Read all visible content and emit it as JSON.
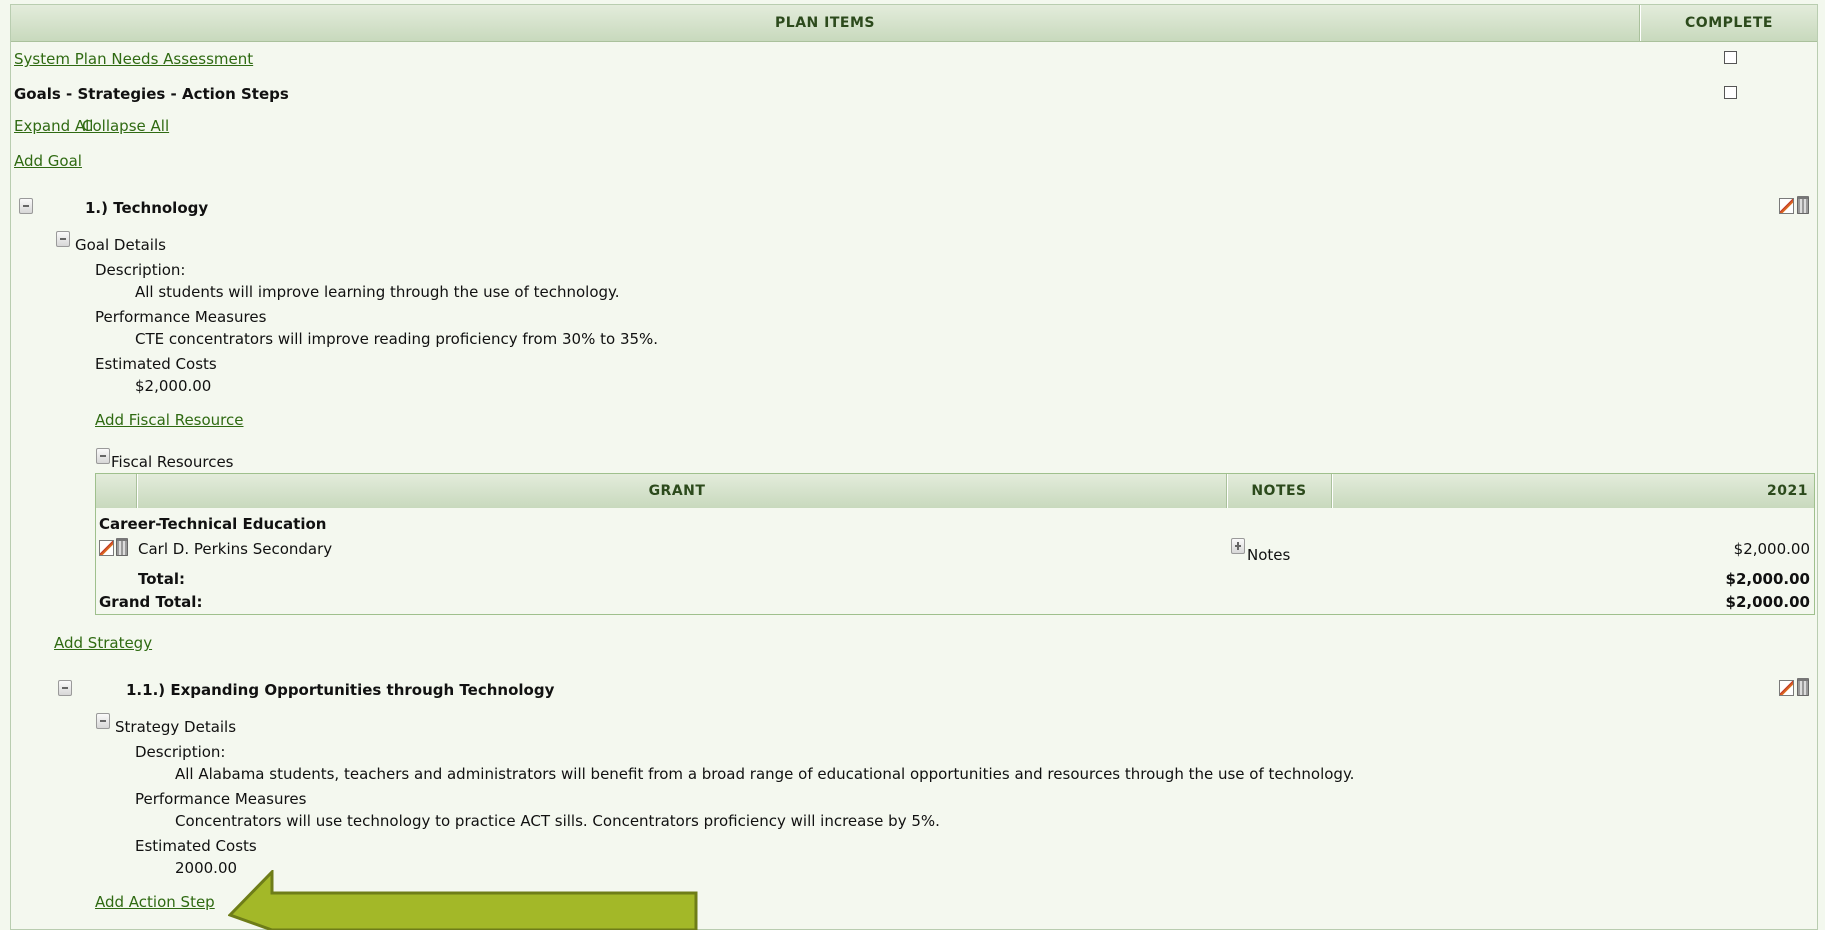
{
  "header": {
    "plan_items": "PLAN ITEMS",
    "complete": "COMPLETE"
  },
  "links": {
    "needs_assessment": "System Plan Needs Assessment",
    "expand_all": "Expand All",
    "collapse_all": "Collapse All",
    "add_goal": "Add Goal",
    "add_fiscal_resource": "Add Fiscal Resource",
    "add_strategy": "Add Strategy",
    "add_action_step": "Add Action Step"
  },
  "section_title": "Goals - Strategies - Action Steps",
  "goal": {
    "title": "1.) Technology",
    "details_label": "Goal Details",
    "description_label": "Description:",
    "description": "All students will improve learning through the use of technology.",
    "measures_label": "Performance Measures",
    "measures": "CTE concentrators will improve reading proficiency from 30% to 35%.",
    "costs_label": "Estimated Costs",
    "costs": "$2,000.00"
  },
  "fiscal": {
    "label": "Fiscal Resources",
    "col_grant": "GRANT",
    "col_notes": "NOTES",
    "col_year": "2021",
    "category": "Career-Technical Education",
    "row_grant": "Carl D. Perkins Secondary",
    "row_notes": "Notes",
    "row_amount": "$2,000.00",
    "total_label": "Total:",
    "total": "$2,000.00",
    "grand_total_label": "Grand Total:",
    "grand_total": "$2,000.00"
  },
  "strategy": {
    "title": "1.1.) Expanding Opportunities through Technology",
    "details_label": "Strategy Details",
    "description_label": "Description:",
    "description": "All Alabama students, teachers and administrators will benefit from a broad range of educational opportunities and resources through the use of technology.",
    "measures_label": "Performance Measures",
    "measures": "Concentrators will use technology to practice ACT sills. Concentrators proficiency will increase by 5%.",
    "costs_label": "Estimated Costs",
    "costs": "2000.00"
  },
  "colors": {
    "accent": "#2f6a12",
    "header_text": "#2c4a1c",
    "arrow": "#a3b828"
  },
  "icons": [
    "minus-icon",
    "plus-icon",
    "edit-icon",
    "trash-icon",
    "checkbox",
    "arrow-left-icon"
  ]
}
